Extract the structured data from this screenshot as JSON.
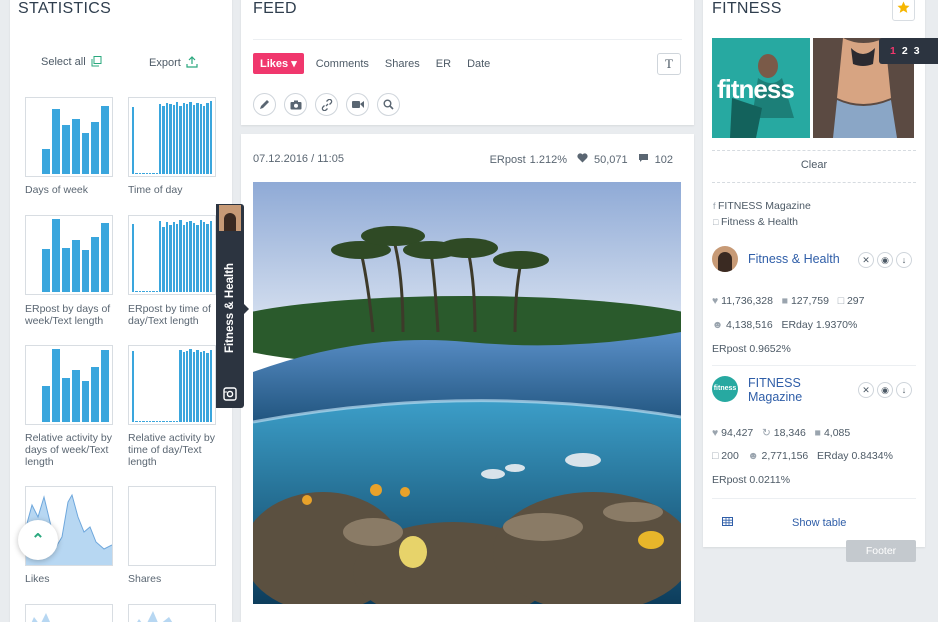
{
  "statistics": {
    "title": "STATISTICS",
    "select_all": "Select all",
    "export": "Export",
    "charts": [
      {
        "label": "Days of week"
      },
      {
        "label": "Time of day"
      },
      {
        "label": "ERpost by days of week/Text length"
      },
      {
        "label": "ERpost by time of day/Text length"
      },
      {
        "label": "Relative activity by days of week/Text length"
      },
      {
        "label": "Relative activity by time of day/Text length"
      },
      {
        "label": "Likes"
      },
      {
        "label": "Shares"
      }
    ]
  },
  "feed": {
    "title": "FEED",
    "filters": [
      "Likes",
      "Comments",
      "Shares",
      "ER",
      "Date"
    ],
    "text_toggle": "T",
    "tools": [
      "pencil-icon",
      "camera-icon",
      "link-icon",
      "video-icon",
      "search-icon"
    ]
  },
  "post": {
    "date": "07.12.2016 / 11:05",
    "erpost_label": "ERpost",
    "erpost": "1.212%",
    "likes": "50,071",
    "comments": "102"
  },
  "side_tab": {
    "label": "Fitness & Health"
  },
  "fitness": {
    "title": "FITNESS",
    "logo_text": "fitness",
    "pager": [
      "1",
      "2",
      "3"
    ],
    "clear": "Clear",
    "sources": [
      "FITNESS Magazine",
      "Fitness & Health"
    ],
    "accounts": [
      {
        "name": "Fitness & Health",
        "likes": "11,736,328",
        "comments": "127,759",
        "posts": "297",
        "followers": "4,138,516",
        "erday_label": "ERday",
        "erday": "1.9370%",
        "erpost_label": "ERpost",
        "erpost": "0.9652%"
      },
      {
        "name_line1": "FITNESS",
        "name_line2": "Magazine",
        "avatar_text": "fitness",
        "likes": "94,427",
        "reposts": "18,346",
        "comments": "4,085",
        "posts": "200",
        "followers": "2,771,156",
        "erday_label": "ERday",
        "erday": "0.8434%",
        "erpost_label": "ERpost",
        "erpost": "0.0211%"
      }
    ],
    "show_table": "Show table"
  },
  "footer_label": "Footer",
  "colors": {
    "accent": "#f0376d",
    "bar": "#3aa6dd",
    "link": "#2f5ea8",
    "dark": "#2c3440",
    "star": "#f6b600"
  }
}
